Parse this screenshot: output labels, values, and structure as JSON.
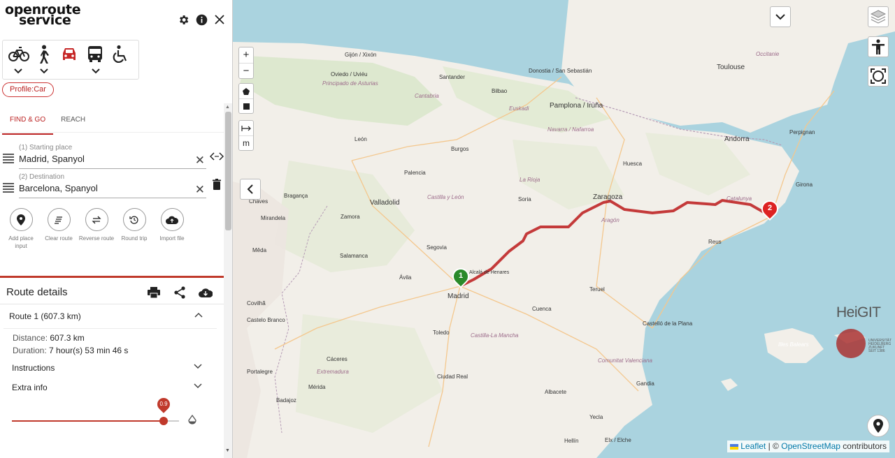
{
  "brand": {
    "line1": "openroute",
    "line2": "service"
  },
  "top_icons": [
    "gear-icon",
    "info-icon",
    "close-icon"
  ],
  "profiles": [
    {
      "name": "bike",
      "icon": "bicycle-icon",
      "has_dropdown": true
    },
    {
      "name": "walk",
      "icon": "walking-icon",
      "has_dropdown": true
    },
    {
      "name": "car",
      "icon": "car-icon",
      "active": true,
      "has_dropdown": false
    },
    {
      "name": "bus",
      "icon": "bus-icon",
      "has_dropdown": true
    },
    {
      "name": "wheelchair",
      "icon": "wheelchair-icon",
      "has_dropdown": false
    }
  ],
  "profile_chip": "Profile:Car",
  "tabs": [
    {
      "label": "FIND & GO",
      "active": true
    },
    {
      "label": "REACH",
      "active": false
    }
  ],
  "places": [
    {
      "label": "(1) Starting place",
      "value": "Madrid, Spanyol"
    },
    {
      "label": "(2) Destination",
      "value": "Barcelona, Spanyol"
    }
  ],
  "actions": [
    {
      "label": "Add place input",
      "icon": "pin-icon"
    },
    {
      "label": "Clear route",
      "icon": "clear-icon"
    },
    {
      "label": "Reverse route",
      "icon": "reverse-icon"
    },
    {
      "label": "Round trip",
      "icon": "round-trip-icon"
    },
    {
      "label": "Import file",
      "icon": "cloud-upload-icon"
    }
  ],
  "route_details": {
    "title": "Route details",
    "route_label": "Route 1 (607.3 km)",
    "distance_label": "Distance:",
    "distance_value": "607.3 km",
    "duration_label": "Duration:",
    "duration_value": "7 hour(s) 53 min 46 s",
    "instructions": "Instructions",
    "extra_info": "Extra info",
    "opacity_value": "0.9"
  },
  "map": {
    "zoom_in": "+",
    "zoom_out": "−",
    "measure_unit": "m",
    "marker_start": "1",
    "marker_end": "2",
    "heigit": "HeiGIT",
    "uni_text": [
      "UNIVERSITÄT",
      "HEIDELBERG",
      "ZUKUNFT",
      "SEIT 1386"
    ],
    "attribution": {
      "leaflet": "Leaflet",
      "sep": "| ©",
      "osm": "OpenStreetMap",
      "contrib": "contributors"
    },
    "labels": [
      {
        "name": "Gijón / Xixón"
      },
      {
        "name": "Oviedo / Uviéu"
      },
      {
        "name": "Santander"
      },
      {
        "name": "Bilbao"
      },
      {
        "name": "Donostia / San Sebastián"
      },
      {
        "name": "Toulouse"
      },
      {
        "name": "Occitanie"
      },
      {
        "name": "Principado de Asturias"
      },
      {
        "name": "Cantabria"
      },
      {
        "name": "Euskadi"
      },
      {
        "name": "Pamplona / Iruña"
      },
      {
        "name": "Navarra / Nafarroa"
      },
      {
        "name": "Perpignan"
      },
      {
        "name": "Andorra"
      },
      {
        "name": "León"
      },
      {
        "name": "Burgos"
      },
      {
        "name": "Huesca"
      },
      {
        "name": "Girona"
      },
      {
        "name": "Palencia"
      },
      {
        "name": "Castilla y León"
      },
      {
        "name": "La Rioja"
      },
      {
        "name": "Zaragoza"
      },
      {
        "name": "Chaves"
      },
      {
        "name": "Bragança"
      },
      {
        "name": "Valladolid"
      },
      {
        "name": "Soria"
      },
      {
        "name": "Catalunya"
      },
      {
        "name": "Zamora"
      },
      {
        "name": "Aragón"
      },
      {
        "name": "Mirandela"
      },
      {
        "name": "Reus"
      },
      {
        "name": "Mêda"
      },
      {
        "name": "Salamanca"
      },
      {
        "name": "Segovia"
      },
      {
        "name": "Ávila"
      },
      {
        "name": "Alcalá de Henares"
      },
      {
        "name": "Madrid"
      },
      {
        "name": "Teruel"
      },
      {
        "name": "Cuenca"
      },
      {
        "name": "Covilhã"
      },
      {
        "name": "Castelo Branco"
      },
      {
        "name": "Castelló de la Plana"
      },
      {
        "name": "Illes Balears"
      },
      {
        "name": "Toledo"
      },
      {
        "name": "Castilla-La Mancha"
      },
      {
        "name": "Cáceres"
      },
      {
        "name": "Comunitat Valenciana"
      },
      {
        "name": "Portalegre"
      },
      {
        "name": "Extremadura"
      },
      {
        "name": "Ciudad Real"
      },
      {
        "name": "Mérida"
      },
      {
        "name": "Badajoz"
      },
      {
        "name": "Gandia"
      },
      {
        "name": "Albacete"
      },
      {
        "name": "Yecla"
      },
      {
        "name": "Elx / Elche"
      },
      {
        "name": "Hellín"
      },
      {
        "name": "Aragón"
      }
    ]
  },
  "colors": {
    "accent": "#c0392b",
    "water": "#aad3df",
    "land": "#f2efe9",
    "route": "#c43a3a",
    "start_marker": "#2a8a2a",
    "end_marker": "#dd2222"
  }
}
